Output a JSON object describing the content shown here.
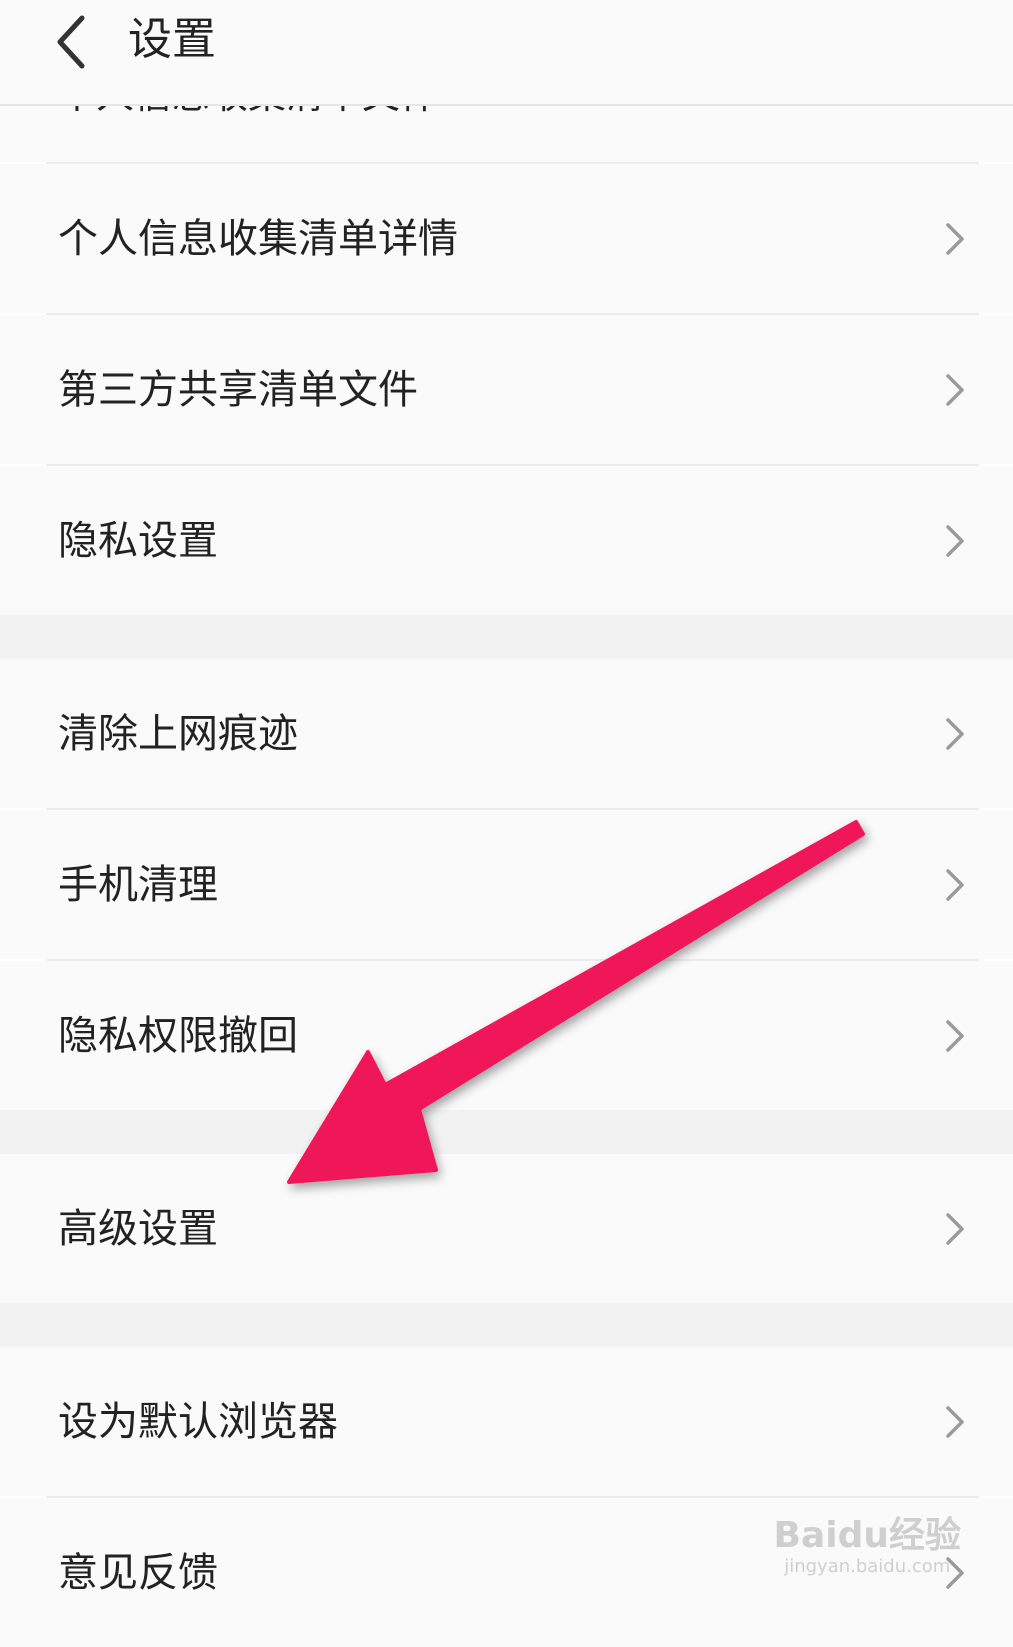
{
  "header": {
    "title": "设置",
    "back_icon": "chevron-left-icon"
  },
  "partial_item": {
    "label": "个人信息收集清单文件"
  },
  "sections": [
    {
      "items": [
        {
          "label": "个人信息收集清单详情"
        },
        {
          "label": "第三方共享清单文件"
        },
        {
          "label": "隐私设置"
        }
      ]
    },
    {
      "items": [
        {
          "label": "清除上网痕迹"
        },
        {
          "label": "手机清理"
        },
        {
          "label": "隐私权限撤回"
        }
      ]
    },
    {
      "items": [
        {
          "label": "高级设置"
        }
      ]
    },
    {
      "items": [
        {
          "label": "设为默认浏览器"
        },
        {
          "label": "意见反馈"
        }
      ]
    }
  ],
  "chevron_icon": "chevron-right-icon",
  "annotation": {
    "arrow_color": "#f0185a",
    "target": "高级设置"
  },
  "watermark": {
    "logo": "Baidu经验",
    "url": "jingyan.baidu.com"
  },
  "colors": {
    "background": "#fafafa",
    "section_gap": "#f2f2f2",
    "divider": "#ececec",
    "text": "#222222",
    "chevron": "#9a9a9a"
  }
}
